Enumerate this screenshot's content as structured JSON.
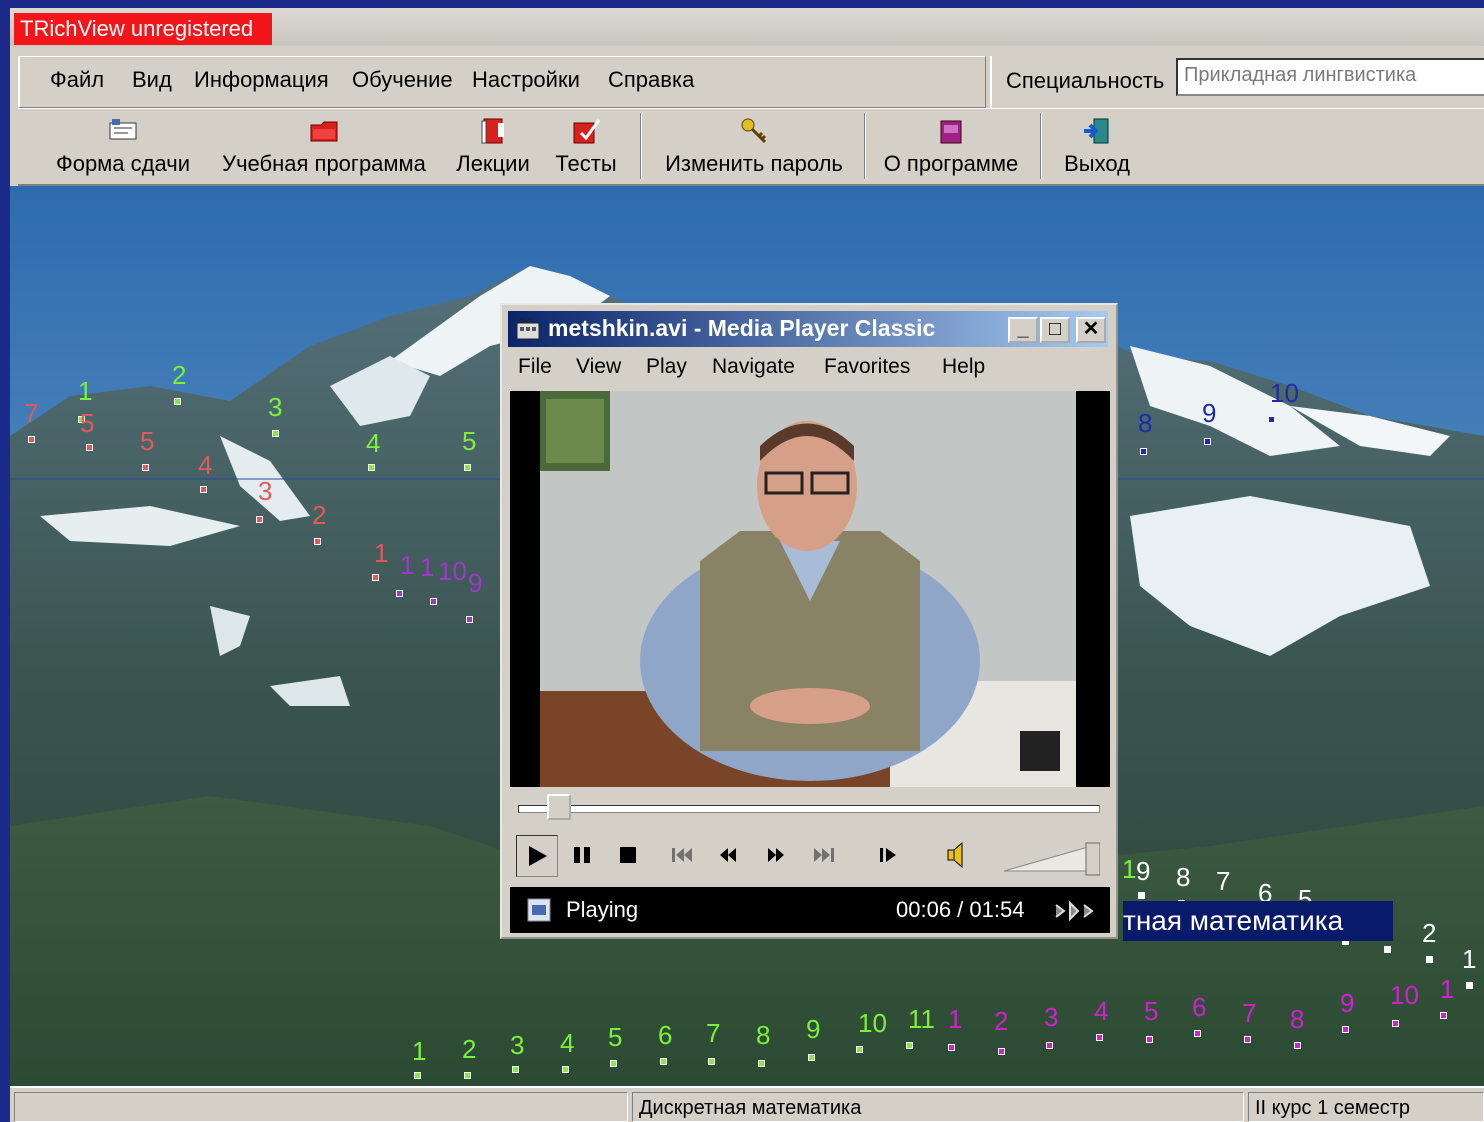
{
  "window": {
    "title": "TRichView unregistered"
  },
  "menu": [
    "Файл",
    "Вид",
    "Информация",
    "Обучение",
    "Настройки",
    "Справка"
  ],
  "specialty": {
    "label": "Специальность",
    "value": "Прикладная лингвистика"
  },
  "toolbar": [
    {
      "label": "Форма сдачи",
      "icon": "form-icon"
    },
    {
      "label": "Учебная программа",
      "icon": "folder-icon"
    },
    {
      "label": "Лекции",
      "icon": "book-icon"
    },
    {
      "label": "Тесты",
      "icon": "tests-icon"
    },
    {
      "label": "Изменить пароль",
      "icon": "key-icon"
    },
    {
      "label": "О программе",
      "icon": "info-book-icon"
    },
    {
      "label": "Выход",
      "icon": "exit-icon"
    }
  ],
  "path_markers": {
    "green_left": [
      "7",
      "1",
      "2",
      "3",
      "4",
      "5"
    ],
    "red_left": [
      "5",
      "5",
      "4",
      "3",
      "2",
      "1"
    ],
    "purple_left": [
      "1",
      "1",
      "10",
      "9"
    ],
    "blue_right": [
      "8",
      "9",
      "10"
    ],
    "white_right": [
      "9",
      "8",
      "7",
      "6",
      "5",
      "2",
      "1"
    ],
    "green_bottom": [
      "1",
      "2",
      "3",
      "4",
      "5",
      "6",
      "7",
      "8",
      "9",
      "10",
      "11"
    ],
    "magenta_bottom": [
      "1",
      "2",
      "3",
      "4",
      "5",
      "6",
      "7",
      "8",
      "9",
      "10",
      "1"
    ],
    "highlight": "тная математика"
  },
  "status": {
    "subject": "Дискретная математика",
    "course": "II курс 1 семестр"
  },
  "player": {
    "title": "metshkin.avi - Media Player Classic",
    "menu": [
      "File",
      "View",
      "Play",
      "Navigate",
      "Favorites",
      "Help"
    ],
    "status": "Playing",
    "time": "00:06 / 01:54",
    "progress": 0.05
  },
  "colors": {
    "title_badge": "#f2161a",
    "green": "#7cf03a",
    "red": "#e05a5a",
    "purple": "#9a3cc8",
    "blue": "#1e2aa8",
    "magenta": "#d020d0"
  }
}
